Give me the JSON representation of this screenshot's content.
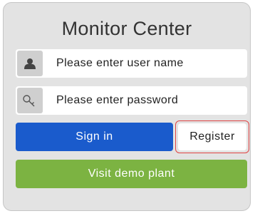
{
  "login": {
    "title": "Monitor Center",
    "username": {
      "icon": "user-icon",
      "placeholder": "Please enter user name",
      "value": ""
    },
    "password": {
      "icon": "key-icon",
      "placeholder": "Please enter password",
      "value": ""
    },
    "buttons": {
      "signin_label": "Sign in",
      "register_label": "Register",
      "demo_label": "Visit demo plant"
    }
  },
  "colors": {
    "card_background": "#e3e3e3",
    "signin_button": "#1a5bcc",
    "demo_button": "#7cb342",
    "register_highlight_border": "#e04444"
  }
}
